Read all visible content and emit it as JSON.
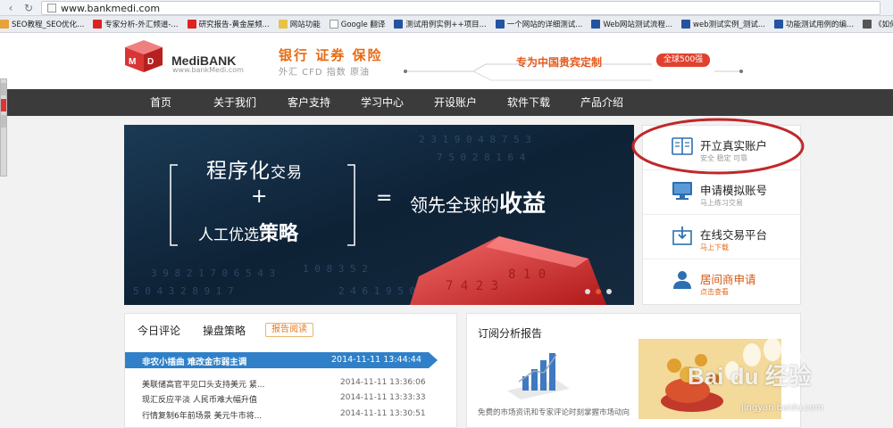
{
  "browser": {
    "url": "www.bankmedi.com",
    "bookmarks": [
      {
        "label": "SEO教程_SEO优化...",
        "color": "#e8a23a"
      },
      {
        "label": "专家分析-外汇频道-...",
        "color": "#d22"
      },
      {
        "label": "研究报告-黄金屋频...",
        "color": "#d22"
      },
      {
        "label": "网站功能",
        "color": "#e5c24a"
      },
      {
        "label": "Google 翻译",
        "color": "#fff"
      },
      {
        "label": "测试用例实例++项目...",
        "color": "#2454a0"
      },
      {
        "label": "一个网站的详细测试...",
        "color": "#2454a0"
      },
      {
        "label": "Web网站测试流程...",
        "color": "#2454a0"
      },
      {
        "label": "web测试实例_测试...",
        "color": "#2454a0"
      },
      {
        "label": "功能测试用例的编...",
        "color": "#2454a0"
      },
      {
        "label": "《如何成为网络推...",
        "color": "#555"
      }
    ]
  },
  "header": {
    "brand": "MediBANK",
    "brand_url": "www.bankMedi.com",
    "slogan": "银行  证券  保险",
    "slogan_sub": "外汇 CFD  指数  原油",
    "vip": "专为中国贵宾定制",
    "badge": "全球500强"
  },
  "nav": {
    "items": [
      "首页",
      "关于我们",
      "客户支持",
      "学习中心",
      "开设账户",
      "软件下载",
      "产品介绍"
    ]
  },
  "banner": {
    "line1_a": "程序化",
    "line1_b": "交易",
    "plus": "+",
    "line3_a": "人工优选",
    "line3_b": "策略",
    "equals": "=",
    "result_a": "领先全球的",
    "result_b": "收益"
  },
  "accounts": [
    {
      "title": "开立真实账户",
      "sub": "安全 稳定 可靠",
      "icon": "book-icon"
    },
    {
      "title": "申请模拟账号",
      "sub": "马上练习交易",
      "icon": "monitor-icon"
    },
    {
      "title": "在线交易平台",
      "sub": "马上下载",
      "icon": "download-icon"
    },
    {
      "title": "居间商申请",
      "sub": "点击查看",
      "icon": "person-icon"
    }
  ],
  "news": {
    "tabs": [
      "今日评论",
      "操盘策略"
    ],
    "tab_button": "报告阅读",
    "headline": {
      "title": "非农小插曲 难改金市弱主调",
      "time": "2014-11-11 13:44:44"
    },
    "rows": [
      {
        "title": "美联储高官平见口头支持美元 紧...",
        "time": "2014-11-11 13:36:06"
      },
      {
        "title": "现汇反应平淡 人民币难大幅升值",
        "time": "2014-11-11 13:33:33"
      },
      {
        "title": "行情复制6年前场景 美元牛市将...",
        "time": "2014-11-11 13:30:51"
      }
    ]
  },
  "subscribe": {
    "title": "订阅分析报告",
    "desc": "免费的市场资讯和专家评论时刻掌握市场动向"
  },
  "watermark": {
    "text": "Bai du 经验",
    "sub": "jingyan.baidu.com"
  },
  "colors": {
    "nav_bg": "#3b3b3b",
    "accent_orange": "#e86a12",
    "headline_blue": "#2f80c8",
    "annotation_red": "#c0282a"
  }
}
